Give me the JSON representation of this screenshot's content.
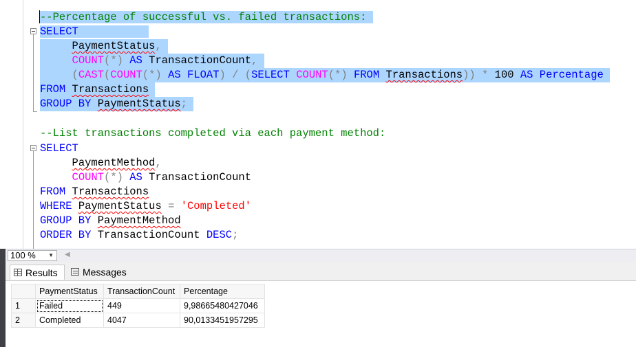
{
  "editor": {
    "comment1": "--Percentage of successful vs. failed transactions:",
    "q1": {
      "select": "SELECT",
      "col1": "PaymentStatus",
      "comma": ",",
      "count_fn": "COUNT",
      "star": "(*)",
      "as": "AS",
      "alias_count": "TransactionCount",
      "open_paren": "(",
      "cast": "CAST",
      "open_paren2": "(",
      "float": "FLOAT",
      "close_paren": ")",
      "divide": "/",
      "sub_select": "SELECT",
      "from_kw": "FROM",
      "table": "Transactions",
      "close_parens": "))",
      "times": "*",
      "hundred": "100",
      "alias_pct": "Percentage",
      "group_by": "GROUP BY",
      "semicolon": ";"
    },
    "comment2": "--List transactions completed via each payment method:",
    "q2": {
      "select": "SELECT",
      "col1": "PaymentMethod",
      "count_fn": "COUNT",
      "star": "(*)",
      "as": "AS",
      "alias_count": "TransactionCount",
      "from_kw": "FROM",
      "table": "Transactions",
      "where_kw": "WHERE",
      "where_col": "PaymentStatus",
      "eq": "=",
      "value": "'Completed'",
      "group_by": "GROUP BY",
      "group_col": "PaymentMethod",
      "order_by": "ORDER BY",
      "order_col": "TransactionCount",
      "desc": "DESC",
      "semicolon": ";"
    }
  },
  "zoom": {
    "value": "100 %"
  },
  "tabs": {
    "results": "Results",
    "messages": "Messages"
  },
  "results": {
    "columns": [
      "PaymentStatus",
      "TransactionCount",
      "Percentage"
    ],
    "rows": [
      {
        "num": "1",
        "status": "Failed",
        "count": "449",
        "pct": "9,98665480427046"
      },
      {
        "num": "2",
        "status": "Completed",
        "count": "4047",
        "pct": "90,0133451957295"
      }
    ]
  },
  "colors": {
    "keyword": "#0000ff",
    "function": "#ff00ff",
    "comment": "#008000",
    "string": "#ff0000",
    "selection": "#add6ff"
  }
}
